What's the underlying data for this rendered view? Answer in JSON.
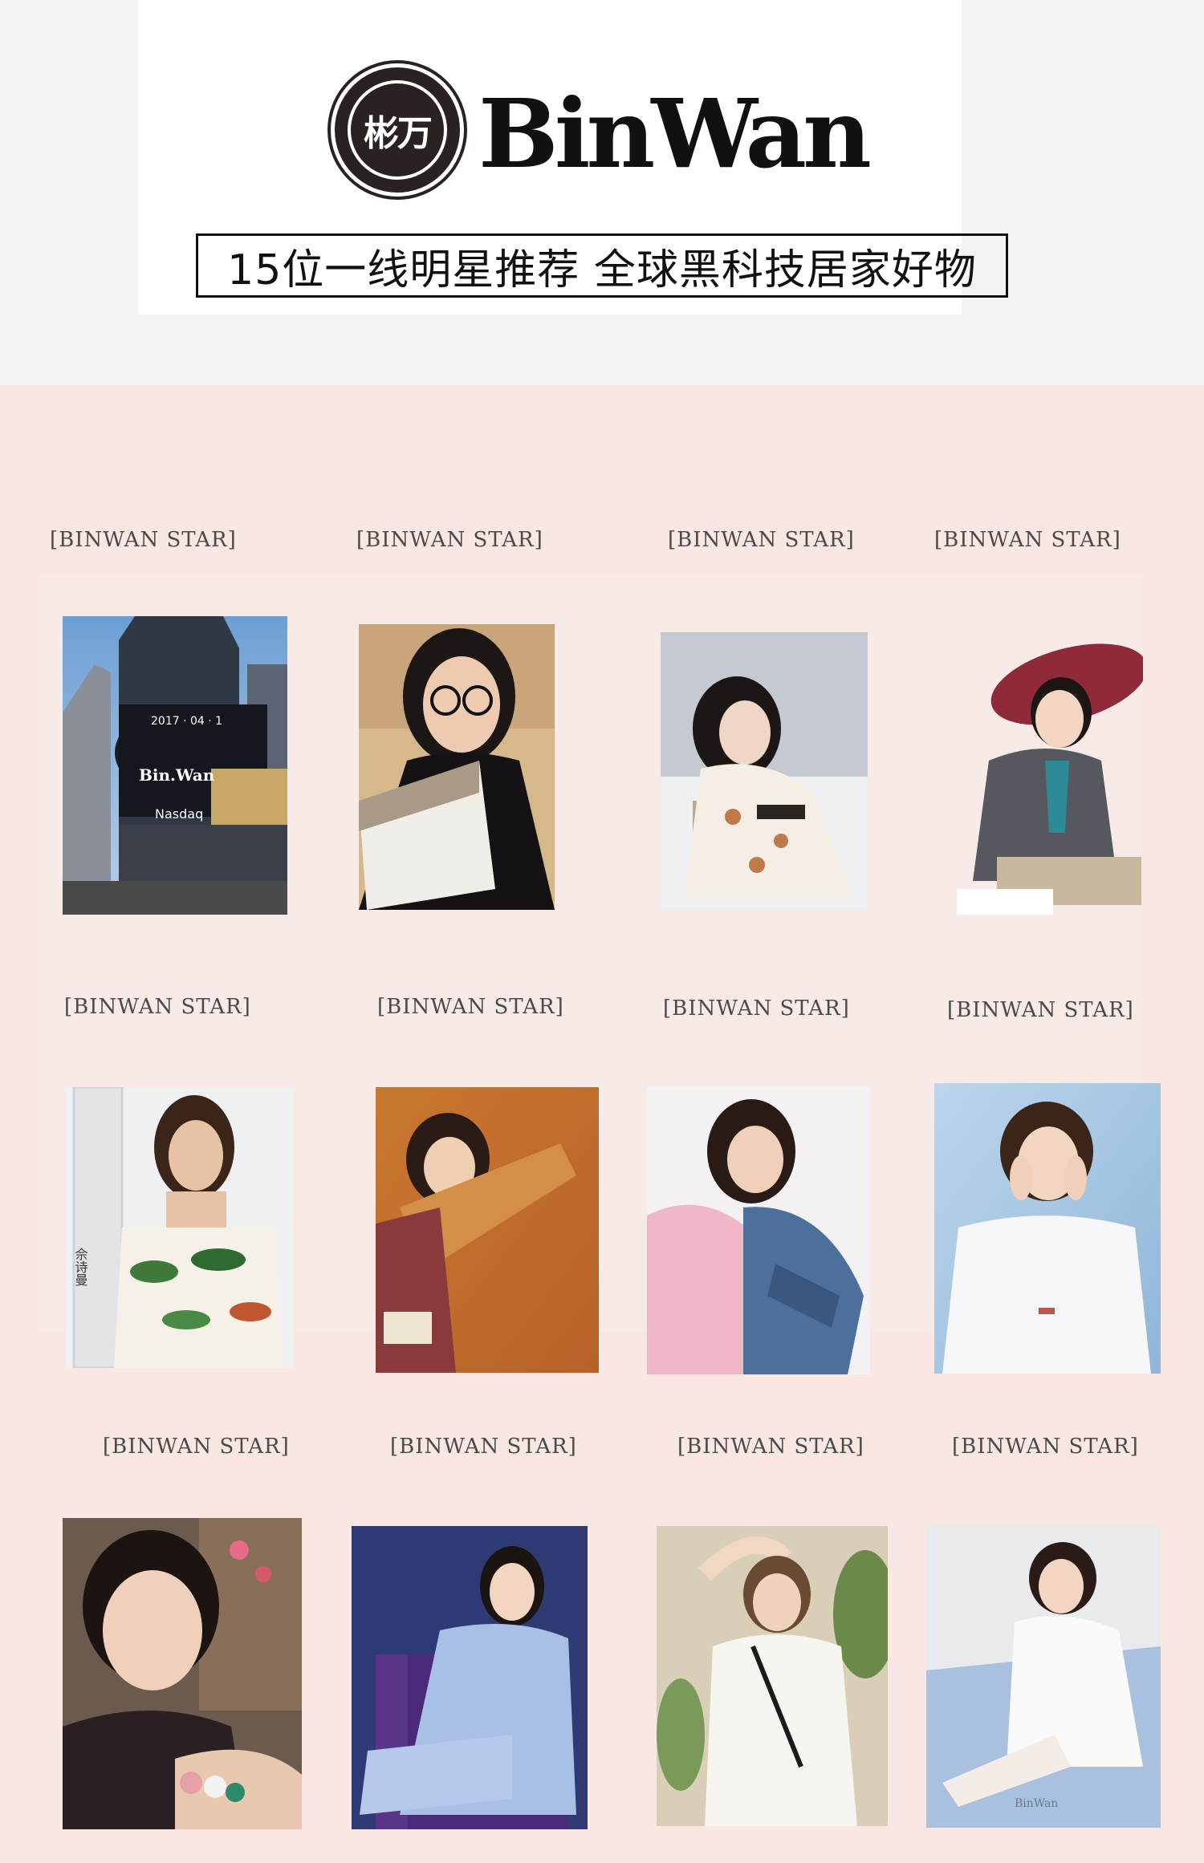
{
  "header": {
    "logo_text": "彬万",
    "brand_name": "BinWan",
    "tagline": "15位一线明星推荐 全球黑科技居家好物"
  },
  "gallery": {
    "label": "[BINWAN STAR]",
    "rows": [
      {
        "labels": [
          "[BINWAN STAR]",
          "[BINWAN STAR]",
          "[BINWAN STAR]",
          "[BINWAN STAR]"
        ]
      },
      {
        "labels": [
          "[BINWAN STAR]",
          "[BINWAN STAR]",
          "[BINWAN STAR]",
          "[BINWAN STAR]"
        ]
      },
      {
        "labels": [
          "[BINWAN STAR]",
          "[BINWAN STAR]",
          "[BINWAN STAR]",
          "[BINWAN STAR]"
        ]
      }
    ],
    "photo_texts": {
      "billboard_date": "2017 · 04 · 1",
      "billboard_brand": "Bin.Wan",
      "billboard_nasdaq": "Nasdaq",
      "vertical_name": "佘诗曼",
      "blanket_brand": "BinWan"
    }
  },
  "colors": {
    "page_bg": "#f4f3f3",
    "header_bg": "#ffffff",
    "gallery_bg": "#f8e7e3",
    "label_text": "#4a4a4a",
    "logo_seal": "#2a2220"
  }
}
